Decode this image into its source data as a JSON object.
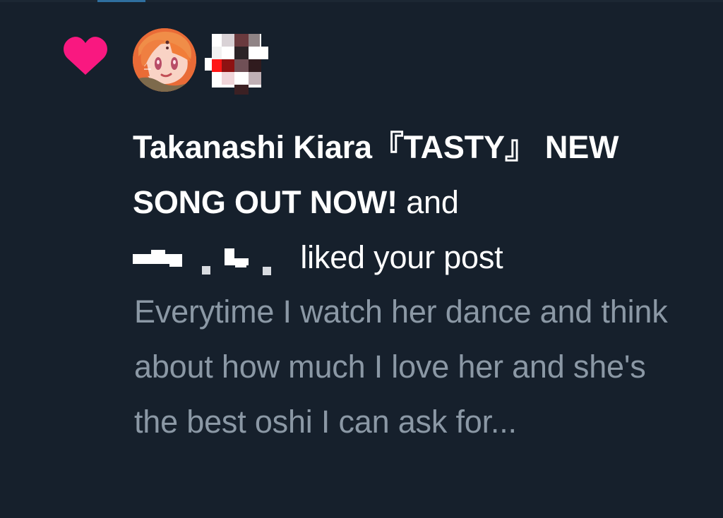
{
  "notification": {
    "type": "like",
    "accent_color": "#f91880",
    "actor_name": "Takanashi Kiara『TASTY』 NEW SONG OUT NOW!",
    "connector": "and",
    "action_text": "liked your post",
    "post_preview": "Everytime I watch her dance and think about how much I love her and she's the best oshi I can ask for...",
    "avatar_icon": "profile-avatar",
    "redacted_icon": "blurred-avatar"
  }
}
